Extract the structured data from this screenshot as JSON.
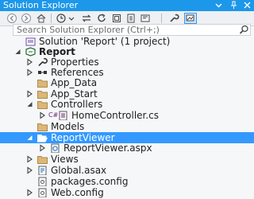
{
  "window": {
    "title": "Solution Explorer"
  },
  "search": {
    "placeholder": "Search Solution Explorer (Ctrl+;)"
  },
  "colors": {
    "accent": "#1c97ea",
    "selection": "#3399ff",
    "folder": "#dcb67a",
    "project": "#6a4aa8"
  },
  "tree": [
    {
      "label": "Solution 'Report' (1 project)",
      "icon": "solution-icon",
      "expander": "none"
    },
    {
      "label": "Report",
      "icon": "csharp-project-icon",
      "expander": "expanded",
      "bold": true
    },
    {
      "label": "Properties",
      "icon": "wrench-icon",
      "expander": "collapsed"
    },
    {
      "label": "References",
      "icon": "references-icon",
      "expander": "collapsed"
    },
    {
      "label": "App_Data",
      "icon": "folder-icon",
      "expander": "none"
    },
    {
      "label": "App_Start",
      "icon": "folder-icon",
      "expander": "collapsed"
    },
    {
      "label": "Controllers",
      "icon": "folder-icon",
      "expander": "expanded"
    },
    {
      "label": "HomeController.cs",
      "icon": "csharp-file-icon",
      "expander": "collapsed",
      "prefix": "C#"
    },
    {
      "label": "Models",
      "icon": "folder-icon",
      "expander": "none"
    },
    {
      "label": "ReportViewer",
      "icon": "folder-open-icon",
      "expander": "expanded",
      "selected": true
    },
    {
      "label": "ReportViewer.aspx",
      "icon": "aspx-file-icon",
      "expander": "collapsed"
    },
    {
      "label": "Views",
      "icon": "folder-icon",
      "expander": "collapsed"
    },
    {
      "label": "Global.asax",
      "icon": "asax-file-icon",
      "expander": "collapsed"
    },
    {
      "label": "packages.config",
      "icon": "config-file-icon",
      "expander": "none"
    },
    {
      "label": "Web.config",
      "icon": "config-file-icon",
      "expander": "collapsed"
    }
  ]
}
